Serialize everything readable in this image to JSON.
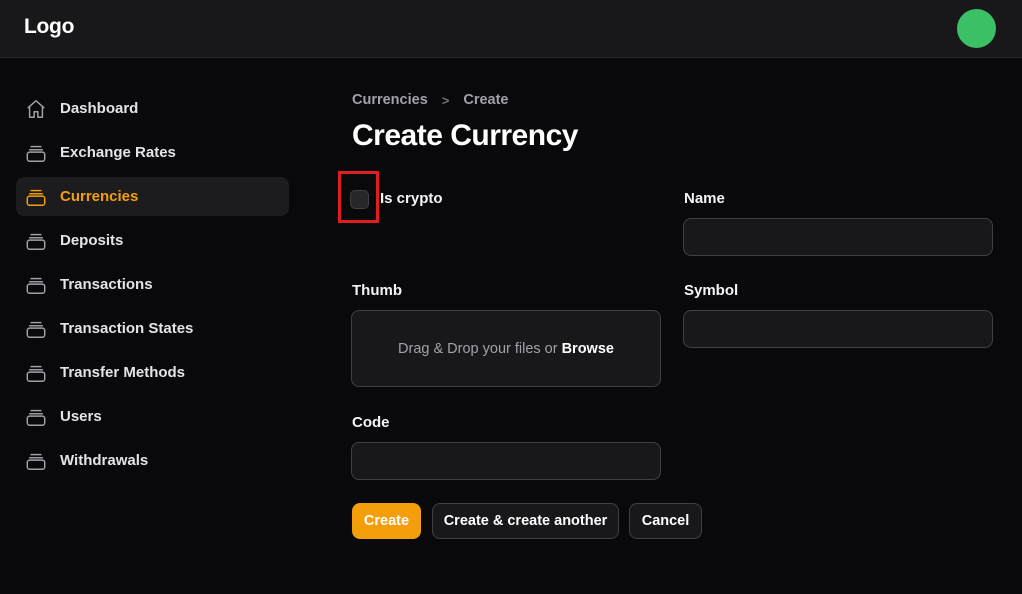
{
  "header": {
    "logo": "Logo",
    "avatar_color": "#3cc066"
  },
  "sidebar": {
    "items": [
      {
        "label": "Dashboard",
        "icon": "home-icon"
      },
      {
        "label": "Exchange Rates",
        "icon": "stack-icon"
      },
      {
        "label": "Currencies",
        "icon": "stack-icon",
        "active": true
      },
      {
        "label": "Deposits",
        "icon": "stack-icon"
      },
      {
        "label": "Transactions",
        "icon": "stack-icon"
      },
      {
        "label": "Transaction States",
        "icon": "stack-icon"
      },
      {
        "label": "Transfer Methods",
        "icon": "stack-icon"
      },
      {
        "label": "Users",
        "icon": "stack-icon"
      },
      {
        "label": "Withdrawals",
        "icon": "stack-icon"
      }
    ]
  },
  "breadcrumb": {
    "parent": "Currencies",
    "separator": ">",
    "current": "Create"
  },
  "page": {
    "title": "Create Currency"
  },
  "form": {
    "is_crypto_label": "Is crypto",
    "is_crypto_checked": false,
    "name_label": "Name",
    "name_value": "",
    "thumb_label": "Thumb",
    "dropzone_text": "Drag & Drop your files or",
    "dropzone_browse": "Browse",
    "symbol_label": "Symbol",
    "symbol_value": "",
    "code_label": "Code",
    "code_value": ""
  },
  "actions": {
    "create": "Create",
    "create_another": "Create & create another",
    "cancel": "Cancel"
  },
  "colors": {
    "accent": "#f59e0b",
    "background": "#09090b",
    "highlight_box": "#e11d22"
  }
}
